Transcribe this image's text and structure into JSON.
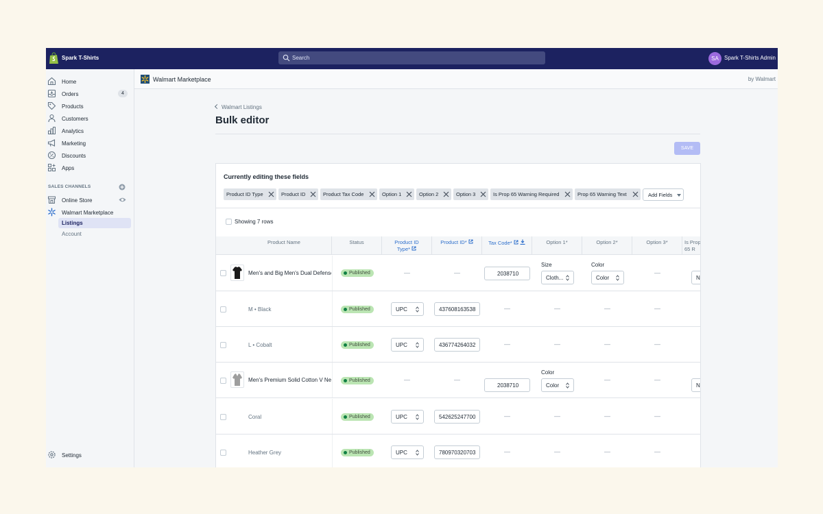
{
  "topbar": {
    "store_name": "Spark T-Shirts",
    "search_placeholder": "Search",
    "avatar_initials": "SA",
    "admin_name": "Spark T-Shirts Admin"
  },
  "sidebar": {
    "items": [
      {
        "label": "Home",
        "icon": "home-icon"
      },
      {
        "label": "Orders",
        "icon": "orders-icon",
        "badge": "4"
      },
      {
        "label": "Products",
        "icon": "tag-icon"
      },
      {
        "label": "Customers",
        "icon": "person-icon"
      },
      {
        "label": "Analytics",
        "icon": "bar-chart-icon"
      },
      {
        "label": "Marketing",
        "icon": "megaphone-icon"
      },
      {
        "label": "Discounts",
        "icon": "discount-icon"
      },
      {
        "label": "Apps",
        "icon": "apps-icon"
      }
    ],
    "sales_channels_title": "SALES CHANNELS",
    "channels": [
      {
        "label": "Online Store",
        "icon": "store-icon"
      },
      {
        "label": "Walmart Marketplace",
        "icon": "walmart-spark-icon"
      }
    ],
    "sub_items": [
      "Listings",
      "Account"
    ],
    "settings_label": "Settings"
  },
  "app": {
    "title": "Walmart Marketplace",
    "by": "by Walmart",
    "back_link": "Walmart Listings",
    "page_title": "Bulk editor",
    "save_label": "SAVE"
  },
  "editing": {
    "title": "Currently editing these fields",
    "chips": [
      "Product ID Type",
      "Product ID",
      "Product Tax Code",
      "Option 1",
      "Option 2",
      "Option 3",
      "Is Prop 65 Warning Required",
      "Prop 65 Warning Text"
    ],
    "add_fields_label": "Add Fields",
    "showing_label": "Showing 7 rows"
  },
  "table": {
    "headers": {
      "product_name": "Product Name",
      "status": "Status",
      "product_id_type": "Product ID Type*",
      "product_id": "Product ID*",
      "tax_code": "Tax Code*",
      "option1": "Option 1*",
      "option2": "Option 2*",
      "option3": "Option 3*",
      "prop65": "Is Prop 65 R"
    },
    "dash": "—",
    "rows": [
      {
        "name": "Men's and Big Men's Dual Defense",
        "status": "Published",
        "tax_code": "2038710",
        "opt1_label": "Size",
        "opt1_value": "Cloth...",
        "opt2_label": "Color",
        "opt2_value": "Color",
        "prop65": "No"
      },
      {
        "name": "M • Black",
        "status": "Published",
        "id_type": "UPC",
        "product_id": "437608163538"
      },
      {
        "name": "L • Cobalt",
        "status": "Published",
        "id_type": "UPC",
        "product_id": "436774264032"
      },
      {
        "name": "Men's Premium Solid Cotton V Neck",
        "status": "Published",
        "tax_code": "2038710",
        "opt1_label": "Color",
        "opt1_value": "Color",
        "prop65": "No"
      },
      {
        "name": "Coral",
        "status": "Published",
        "id_type": "UPC",
        "product_id": "542625247700"
      },
      {
        "name": "Heather Grey",
        "status": "Published",
        "id_type": "UPC",
        "product_id": "780970320703"
      }
    ]
  },
  "colors": {
    "topbar": "#1c2260",
    "accent": "#2c6ecb",
    "published_badge": "#bbe5b3",
    "save_disabled": "#b3bcf5"
  }
}
